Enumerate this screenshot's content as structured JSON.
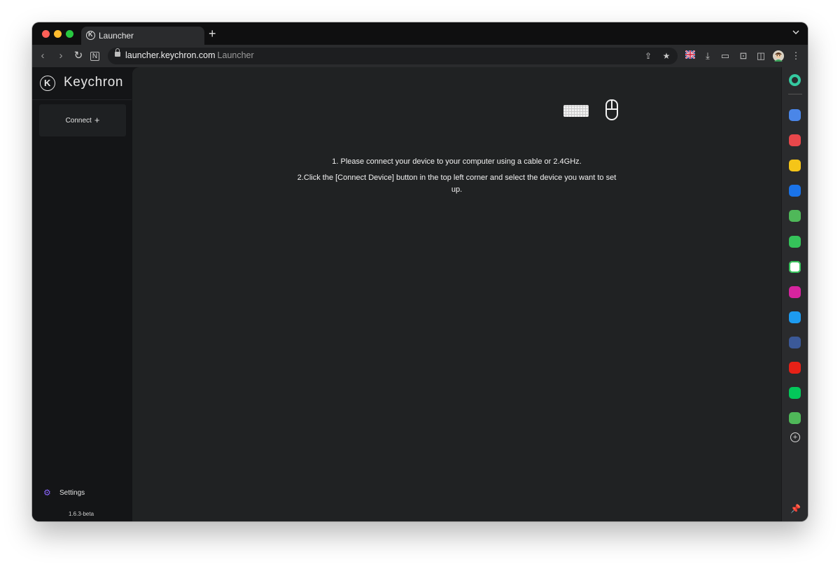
{
  "browser": {
    "tab_title": "Launcher",
    "new_tab_symbol": "+",
    "url": "launcher.keychron.com",
    "url_page_title": "Launcher"
  },
  "sidebar": {
    "brand_mark": "K",
    "brand_name": "Keychron",
    "connect_label": "Connect",
    "connect_symbol": "+",
    "settings_label": "Settings",
    "version": "1.6.3-beta"
  },
  "main": {
    "instruction_1": "1. Please connect your device to your computer using a cable or 2.4GHz.",
    "instruction_2": "2.Click the [Connect Device] button in the top left corner and select the device you want to set up."
  },
  "extensions": [
    {
      "name": "calendar",
      "color": "#4a86e8"
    },
    {
      "name": "pocket",
      "color": "#e8474b"
    },
    {
      "name": "star",
      "color": "#f5c518"
    },
    {
      "name": "chrome",
      "color": "#1a73e8"
    },
    {
      "name": "evernote",
      "color": "#4fb859"
    },
    {
      "name": "chat",
      "color": "#35c35a"
    },
    {
      "name": "mail",
      "color": "#ffffff"
    },
    {
      "name": "instagram",
      "color": "#d6249f"
    },
    {
      "name": "twitter",
      "color": "#1d9bf0"
    },
    {
      "name": "facebook",
      "color": "#3b5998"
    },
    {
      "name": "youtube",
      "color": "#e62117"
    },
    {
      "name": "naver",
      "color": "#03c75a"
    },
    {
      "name": "info",
      "color": "#4fb859"
    }
  ]
}
